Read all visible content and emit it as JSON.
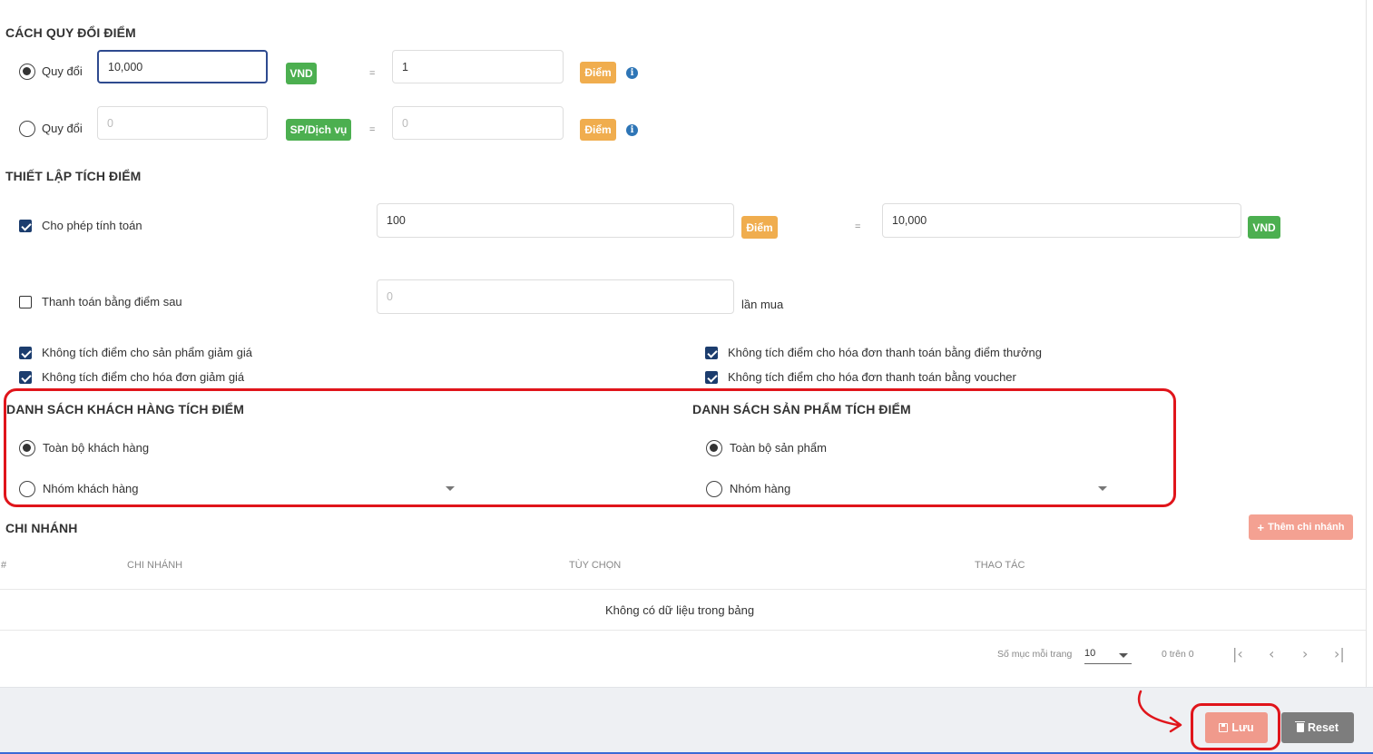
{
  "conversion": {
    "title": "CÁCH QUY ĐỔI ĐIỂM",
    "row1": {
      "label": "Quy đổi",
      "amount": "10,000",
      "unit": "VND",
      "eq": "=",
      "points": "1",
      "points_unit": "Điểm",
      "selected": true
    },
    "row2": {
      "label": "Quy đổi",
      "amount": "0",
      "unit": "SP/Dịch vụ",
      "eq": "=",
      "points": "0",
      "points_unit": "Điểm",
      "selected": false
    }
  },
  "accumulate": {
    "title": "THIẾT LẬP TÍCH ĐIỂM",
    "allow_calc": {
      "label": "Cho phép tính toán",
      "checked": true,
      "points": "100",
      "points_unit": "Điểm",
      "eq": "=",
      "vnd": "10,000",
      "vnd_unit": "VND"
    },
    "pay_after": {
      "label": "Thanh toán bằng điểm sau",
      "checked": false,
      "value": "0",
      "suffix": "lần mua"
    },
    "options": [
      {
        "label": "Không tích điểm cho sản phẩm giảm giá",
        "checked": true
      },
      {
        "label": "Không tích điểm cho hóa đơn giảm giá",
        "checked": true
      },
      {
        "label": "Không tích điểm cho hóa đơn thanh toán bằng điểm thưởng",
        "checked": true
      },
      {
        "label": "Không tích điểm cho hóa đơn thanh toán bằng voucher",
        "checked": true
      }
    ]
  },
  "customers": {
    "title": "DANH SÁCH KHÁCH HÀNG TÍCH ĐIỂM",
    "all": "Toàn bộ khách hàng",
    "group": "Nhóm khách hàng"
  },
  "products": {
    "title": "DANH SÁCH SẢN PHẨM TÍCH ĐIỂM",
    "all": "Toàn bộ sản phẩm",
    "group": "Nhóm hàng"
  },
  "branches": {
    "title": "CHI NHÁNH",
    "add_button": "Thêm chi nhánh",
    "columns": [
      "#",
      "CHI NHÁNH",
      "TÙY CHỌN",
      "THAO TÁC"
    ],
    "empty_text": "Không có dữ liệu trong bảng",
    "per_page_label": "Số mục mỗi trang",
    "per_page_value": "10",
    "range_text": "0 trên 0"
  },
  "footer": {
    "save_label": "Lưu",
    "reset_label": "Reset"
  },
  "colors": {
    "green": "#4caf50",
    "orange": "#f0ad4e",
    "highlight": "#e0151b",
    "save": "#f09a8c",
    "reset": "#7d7d7d",
    "add_branch": "#f4a192"
  }
}
